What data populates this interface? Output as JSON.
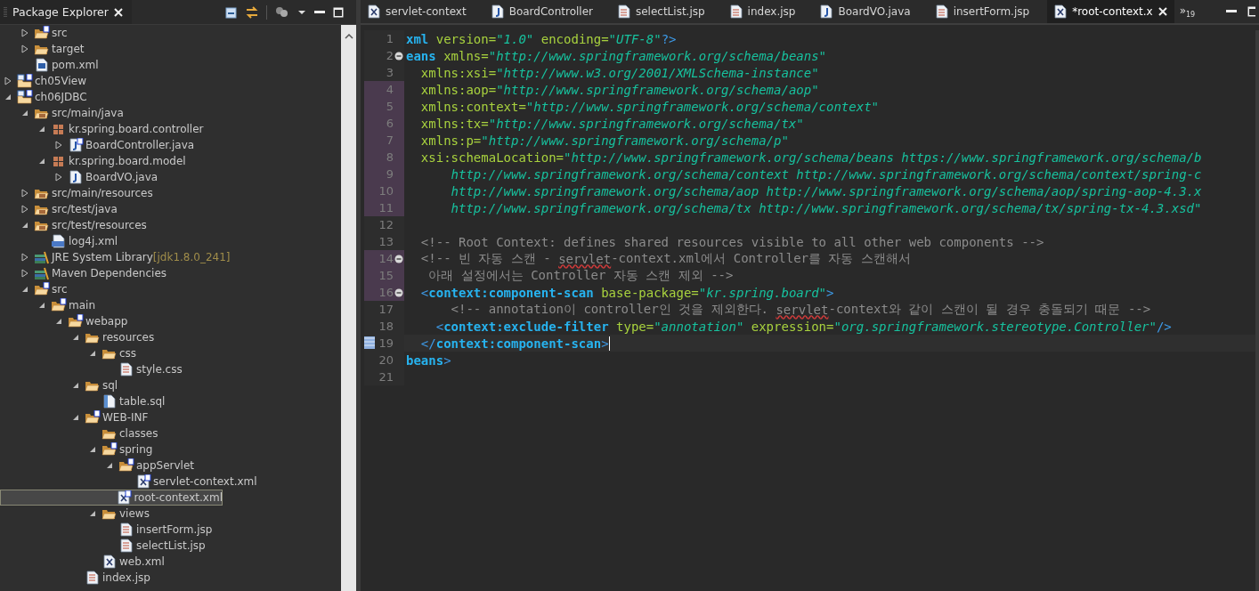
{
  "explorer": {
    "title": "Package Explorer",
    "scrolled_parent_children": [
      {
        "label": "src",
        "kind": "spring-folder",
        "expanded": false,
        "selected": false
      },
      {
        "label": "target",
        "kind": "folder",
        "expanded": false,
        "selected": false
      },
      {
        "label": "pom.xml",
        "kind": "maven-file",
        "selected": false
      }
    ],
    "tree": [
      {
        "label": "ch05View",
        "kind": "project",
        "expanded": false,
        "selected": false
      },
      {
        "label": "ch06JDBC",
        "kind": "project",
        "expanded": true,
        "selected": false,
        "children": [
          {
            "label": "src/main/java",
            "kind": "source-folder",
            "expanded": true,
            "selected": false,
            "children": [
              {
                "label": "kr.spring.board.controller",
                "kind": "package",
                "expanded": true,
                "selected": false,
                "children": [
                  {
                    "label": "BoardController.java",
                    "kind": "spring-java-file",
                    "expanded": false,
                    "selected": false
                  }
                ]
              },
              {
                "label": "kr.spring.board.model",
                "kind": "package",
                "expanded": true,
                "selected": false,
                "children": [
                  {
                    "label": "BoardVO.java",
                    "kind": "java-file",
                    "expanded": false,
                    "selected": false
                  }
                ]
              }
            ]
          },
          {
            "label": "src/main/resources",
            "kind": "source-folder",
            "expanded": false,
            "selected": false
          },
          {
            "label": "src/test/java",
            "kind": "source-folder",
            "expanded": false,
            "selected": false
          },
          {
            "label": "src/test/resources",
            "kind": "source-folder",
            "expanded": true,
            "selected": false,
            "children": [
              {
                "label": "log4j.xml",
                "kind": "config-file",
                "selected": false
              }
            ]
          },
          {
            "label": "JRE System Library",
            "decoration": "[jdk1.8.0_241]",
            "kind": "library",
            "expanded": false,
            "selected": false
          },
          {
            "label": "Maven Dependencies",
            "kind": "library",
            "expanded": false,
            "selected": false
          },
          {
            "label": "src",
            "kind": "spring-folder",
            "expanded": true,
            "selected": false,
            "children": [
              {
                "label": "main",
                "kind": "spring-folder",
                "expanded": true,
                "selected": false,
                "children": [
                  {
                    "label": "webapp",
                    "kind": "spring-folder",
                    "expanded": true,
                    "selected": false,
                    "children": [
                      {
                        "label": "resources",
                        "kind": "folder",
                        "expanded": true,
                        "selected": false,
                        "children": [
                          {
                            "label": "css",
                            "kind": "folder",
                            "expanded": true,
                            "selected": false,
                            "children": [
                              {
                                "label": "style.css",
                                "kind": "text-file",
                                "selected": false
                              }
                            ]
                          }
                        ]
                      },
                      {
                        "label": "sql",
                        "kind": "folder",
                        "expanded": true,
                        "selected": false,
                        "children": [
                          {
                            "label": "table.sql",
                            "kind": "sql-file",
                            "selected": false
                          }
                        ]
                      },
                      {
                        "label": "WEB-INF",
                        "kind": "spring-folder",
                        "expanded": true,
                        "selected": false,
                        "children": [
                          {
                            "label": "classes",
                            "kind": "folder",
                            "selected": false
                          },
                          {
                            "label": "spring",
                            "kind": "spring-folder",
                            "expanded": true,
                            "selected": false,
                            "children": [
                              {
                                "label": "appServlet",
                                "kind": "spring-folder",
                                "expanded": true,
                                "selected": false,
                                "children": [
                                  {
                                    "label": "servlet-context.xml",
                                    "kind": "spring-xml-file",
                                    "selected": false
                                  }
                                ]
                              },
                              {
                                "label": "root-context.xml",
                                "kind": "spring-xml-file",
                                "selected": true
                              }
                            ]
                          },
                          {
                            "label": "views",
                            "kind": "folder",
                            "expanded": true,
                            "selected": false,
                            "children": [
                              {
                                "label": "insertForm.jsp",
                                "kind": "text-file",
                                "selected": false
                              },
                              {
                                "label": "selectList.jsp",
                                "kind": "text-file",
                                "selected": false
                              }
                            ]
                          },
                          {
                            "label": "web.xml",
                            "kind": "xml-file",
                            "selected": false
                          }
                        ]
                      },
                      {
                        "label": "index.jsp",
                        "kind": "text-file",
                        "selected": false
                      }
                    ]
                  }
                ]
              }
            ]
          }
        ]
      }
    ]
  },
  "editor": {
    "tabs": [
      {
        "label": "servlet-context",
        "kind": "xml",
        "selected": false
      },
      {
        "label": "BoardController",
        "kind": "java",
        "selected": false
      },
      {
        "label": "selectList.jsp",
        "kind": "jsp",
        "selected": false
      },
      {
        "label": "index.jsp",
        "kind": "jsp",
        "selected": false
      },
      {
        "label": "BoardVO.java",
        "kind": "java",
        "selected": false
      },
      {
        "label": "insertForm.jsp",
        "kind": "jsp",
        "selected": false
      },
      {
        "label": "*root-context.x",
        "kind": "xml",
        "selected": true
      }
    ],
    "overflow": {
      "symbol": "»",
      "count": "19"
    },
    "lines": [
      {
        "number": "1",
        "changed": false,
        "fold": false,
        "current": false,
        "tokens": [
          {
            "kind": "tag",
            "text": "xml"
          },
          {
            "kind": "attr",
            "text": " version="
          },
          {
            "kind": "value",
            "text": "\"1.0\""
          },
          {
            "kind": "attr",
            "text": " encoding="
          },
          {
            "kind": "value",
            "text": "\"UTF-8\""
          },
          {
            "kind": "bracket",
            "text": "?>"
          }
        ]
      },
      {
        "number": "2",
        "changed": false,
        "fold": true,
        "current": false,
        "tokens": [
          {
            "kind": "tag",
            "text": "eans"
          },
          {
            "kind": "attr",
            "text": " xmlns="
          },
          {
            "kind": "value",
            "text": "\"http://www.springframework.org/schema/beans\""
          }
        ]
      },
      {
        "number": "3",
        "changed": false,
        "fold": false,
        "current": false,
        "tokens": [
          {
            "kind": "attr",
            "text": "  xmlns:xsi="
          },
          {
            "kind": "value",
            "text": "\"http://www.w3.org/2001/XMLSchema-instance\""
          }
        ]
      },
      {
        "number": "4",
        "changed": true,
        "fold": false,
        "current": false,
        "tokens": [
          {
            "kind": "attr",
            "text": "  xmlns:aop="
          },
          {
            "kind": "value",
            "text": "\"http://www.springframework.org/schema/aop\""
          }
        ]
      },
      {
        "number": "5",
        "changed": true,
        "fold": false,
        "current": false,
        "tokens": [
          {
            "kind": "attr",
            "text": "  xmlns:context="
          },
          {
            "kind": "value",
            "text": "\"http://www.springframework.org/schema/context\""
          }
        ]
      },
      {
        "number": "6",
        "changed": true,
        "fold": false,
        "current": false,
        "tokens": [
          {
            "kind": "attr",
            "text": "  xmlns:tx="
          },
          {
            "kind": "value",
            "text": "\"http://www.springframework.org/schema/tx\""
          }
        ]
      },
      {
        "number": "7",
        "changed": true,
        "fold": false,
        "current": false,
        "tokens": [
          {
            "kind": "attr",
            "text": "  xmlns:p="
          },
          {
            "kind": "value",
            "text": "\"http://www.springframework.org/schema/p\""
          }
        ]
      },
      {
        "number": "8",
        "changed": true,
        "fold": false,
        "current": false,
        "tokens": [
          {
            "kind": "attr",
            "text": "  xsi:schemaLocation="
          },
          {
            "kind": "value",
            "text": "\"http://www.springframework.org/schema/beans https://www.springframework.org/schema/b"
          }
        ]
      },
      {
        "number": "9",
        "changed": true,
        "fold": false,
        "current": false,
        "tokens": [
          {
            "kind": "value",
            "text": "      http://www.springframework.org/schema/context http://www.springframework.org/schema/context/spring-c"
          }
        ]
      },
      {
        "number": "10",
        "changed": true,
        "fold": false,
        "current": false,
        "tokens": [
          {
            "kind": "value",
            "text": "      http://www.springframework.org/schema/aop http://www.springframework.org/schema/aop/spring-aop-4.3.x"
          }
        ]
      },
      {
        "number": "11",
        "changed": true,
        "fold": false,
        "current": false,
        "tokens": [
          {
            "kind": "value",
            "text": "      http://www.springframework.org/schema/tx http://www.springframework.org/schema/tx/spring-tx-4.3.xsd\""
          }
        ]
      },
      {
        "number": "12",
        "changed": false,
        "fold": false,
        "current": false
      },
      {
        "number": "13",
        "changed": false,
        "fold": false,
        "current": false,
        "tokens": [
          {
            "kind": "comment",
            "text": "  <!-- Root Context: defines shared resources visible to all other web components -->"
          }
        ]
      },
      {
        "number": "14",
        "changed": true,
        "fold": true,
        "current": false,
        "tokens": [
          {
            "kind": "comment",
            "text": "  <!-- 빈 자동 스캔 - "
          },
          {
            "kind": "misspelled",
            "text": "servlet"
          },
          {
            "kind": "comment",
            "text": "-context.xml에서 Controller를 자동 스캔해서"
          }
        ]
      },
      {
        "number": "15",
        "changed": true,
        "fold": false,
        "current": false,
        "tokens": [
          {
            "kind": "comment",
            "text": "   아래 설정에서는 Controller 자동 스캔 제외 -->"
          }
        ]
      },
      {
        "number": "16",
        "changed": true,
        "fold": true,
        "current": false,
        "tokens": [
          {
            "kind": "bracket",
            "text": "  <"
          },
          {
            "kind": "tag",
            "text": "context:component-scan"
          },
          {
            "kind": "attr",
            "text": " base-package="
          },
          {
            "kind": "value",
            "text": "\"kr.spring.board\""
          },
          {
            "kind": "bracket",
            "text": ">"
          }
        ]
      },
      {
        "number": "17",
        "changed": false,
        "fold": false,
        "current": false,
        "tokens": [
          {
            "kind": "comment",
            "text": "      <!-- annotation이 controller인 것을 제외한다. "
          },
          {
            "kind": "misspelled",
            "text": "servlet"
          },
          {
            "kind": "comment",
            "text": "-context와 같이 스캔이 될 경우 충돌되기 때문 -->"
          }
        ]
      },
      {
        "number": "18",
        "changed": false,
        "fold": false,
        "current": false,
        "tokens": [
          {
            "kind": "bracket",
            "text": "    <"
          },
          {
            "kind": "tag",
            "text": "context:exclude-filter"
          },
          {
            "kind": "attr",
            "text": " type="
          },
          {
            "kind": "value",
            "text": "\"annotation\""
          },
          {
            "kind": "attr",
            "text": " expression="
          },
          {
            "kind": "value",
            "text": "\"org.springframework.stereotype.Controller\""
          },
          {
            "kind": "bracket",
            "text": "/>"
          }
        ]
      },
      {
        "number": "19",
        "changed": false,
        "fold": false,
        "current": true,
        "tokens": [
          {
            "kind": "bracket",
            "text": "  </"
          },
          {
            "kind": "tag",
            "text": "context:component-scan"
          },
          {
            "kind": "bracket",
            "text": ">"
          }
        ]
      },
      {
        "number": "20",
        "changed": false,
        "fold": false,
        "current": false,
        "tokens": [
          {
            "kind": "tag",
            "text": "beans"
          },
          {
            "kind": "bracket",
            "text": ">"
          }
        ]
      },
      {
        "number": "21",
        "changed": false,
        "fold": false,
        "current": false
      }
    ]
  }
}
